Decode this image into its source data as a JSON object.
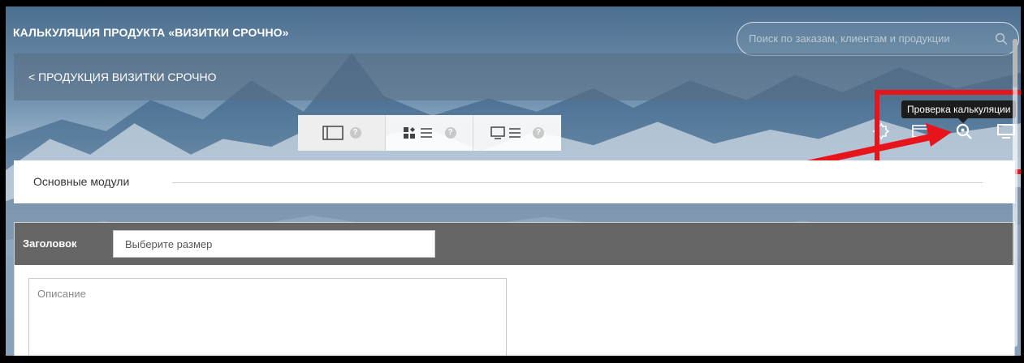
{
  "header": {
    "title": "КАЛЬКУЛЯЦИЯ ПРОДУКТА «ВИЗИТКИ СРОЧНО»",
    "search_placeholder": "Поиск по заказам, клиентам и продукции"
  },
  "breadcrumb": {
    "label": "< ПРОДУКЦИЯ ВИЗИТКИ СРОЧНО"
  },
  "view_switcher": {
    "buttons": [
      {
        "icon": "single-panel-icon",
        "help": "?"
      },
      {
        "icon": "grid-list-icon",
        "help": "?"
      },
      {
        "icon": "monitor-list-icon",
        "help": "?"
      }
    ]
  },
  "toolbar": {
    "icons": [
      "settings-icon",
      "calculator-icon",
      "search-zoom-icon",
      "monitor-icon"
    ],
    "tooltip": "Проверка калькуляции"
  },
  "section": {
    "title": "Основные модули"
  },
  "panel": {
    "header_label": "Заголовок",
    "size_placeholder": "Выберите размер",
    "description_placeholder": "Описание"
  },
  "colors": {
    "highlight": "#e8141b",
    "panel_header": "#666666",
    "tooltip_bg": "#1c1c1c"
  }
}
